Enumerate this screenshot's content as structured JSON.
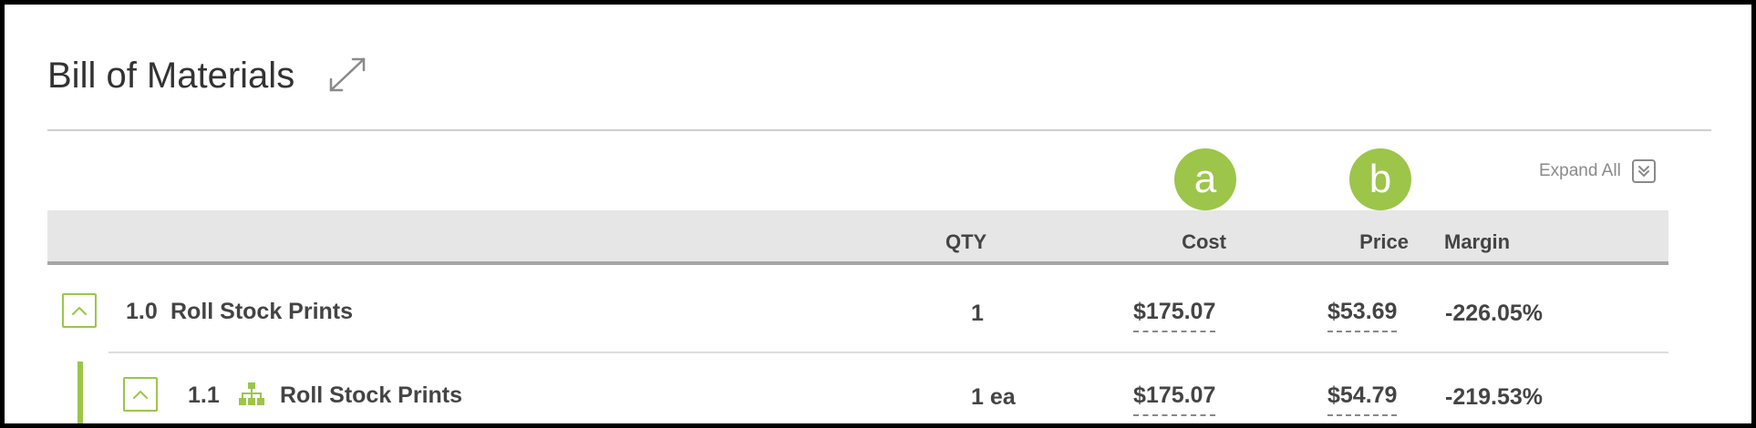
{
  "page": {
    "title": "Bill of Materials",
    "expand_all_label": "Expand All"
  },
  "badges": {
    "a": "a",
    "b": "b"
  },
  "table": {
    "headers": {
      "qty": "QTY",
      "cost": "Cost",
      "price": "Price",
      "margin": "Margin"
    },
    "rows": [
      {
        "num": "1.0",
        "name": "Roll Stock Prints",
        "qty": "1",
        "cost": "$175.07",
        "price": "$53.69",
        "margin": "-226.05%"
      },
      {
        "num": "1.1",
        "name": "Roll Stock Prints",
        "qty": "1 ea",
        "cost": "$175.07",
        "price": "$54.79",
        "margin": "-219.53%"
      }
    ]
  },
  "colors": {
    "accent": "#9cc54a",
    "header_bg": "#e6e6e6",
    "text": "#444444"
  },
  "icons": {
    "expand": "expand-diagonal-icon",
    "expand_all": "double-chevron-down-icon",
    "toggle": "chevron-up-icon",
    "hierarchy": "hierarchy-icon"
  }
}
